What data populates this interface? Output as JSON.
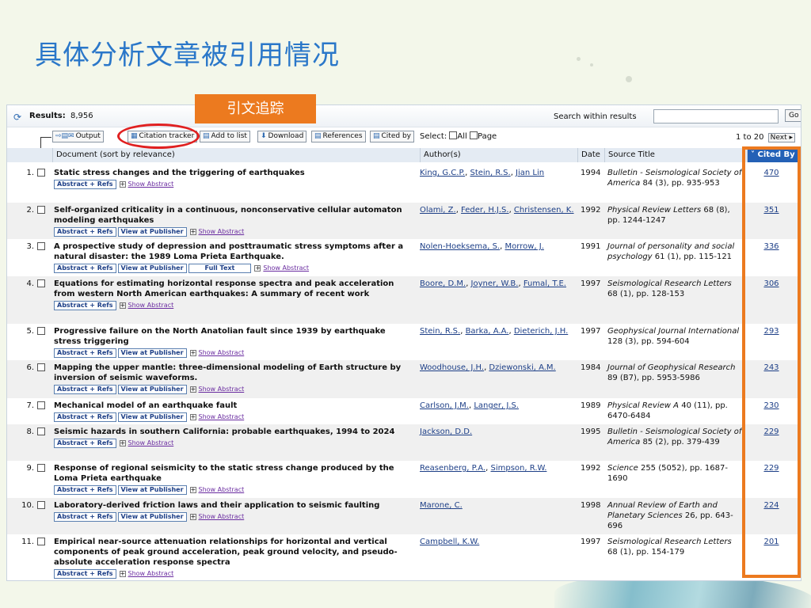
{
  "slide_title": "具体分析文章被引用情况",
  "callout_label": "引文追踪",
  "results": {
    "label": "Results:",
    "count": "8,956"
  },
  "search": {
    "label": "Search within results",
    "value": "",
    "go_label": "Go"
  },
  "toolbar": {
    "output": "Output",
    "citation_tracker": "Citation tracker",
    "add_to_list": "Add to list",
    "download": "Download",
    "references": "References",
    "cited_by": "Cited by"
  },
  "select": {
    "label": "Select:",
    "all": "All",
    "page": "Page"
  },
  "paging": {
    "range": "1 to 20",
    "next": "Next"
  },
  "columns": {
    "document": "Document (sort by relevance)",
    "authors": "Author(s)",
    "date": "Date",
    "source": "Source Title",
    "cited_by": "Cited By"
  },
  "link_labels": {
    "abstract_refs": "Abstract + Refs",
    "view_publisher": "View at Publisher",
    "full_text": "Full Text",
    "show_abstract": "Show Abstract"
  },
  "rows": [
    {
      "num": "1.",
      "title": "Static stress changes and the triggering of earthquakes",
      "authors": [
        "King, G.C.P.",
        "Stein, R.S.",
        "Jian Lin"
      ],
      "year": "1994",
      "source_title": "Bulletin - Seismological Society of America",
      "source_detail": "84 (3), pp. 935-953",
      "cited": "470",
      "publisher": false,
      "fulltext": false
    },
    {
      "num": "2.",
      "title": "Self-organized criticality in a continuous, nonconservative cellular automaton modeling earthquakes",
      "authors": [
        "Olami, Z.",
        "Feder, H.J.S.",
        "Christensen, K."
      ],
      "year": "1992",
      "source_title": "Physical Review Letters",
      "source_detail": "68 (8), pp. 1244-1247",
      "cited": "351",
      "publisher": true,
      "fulltext": false
    },
    {
      "num": "3.",
      "title": "A prospective study of depression and posttraumatic stress symptoms after a natural disaster: the 1989 Loma Prieta Earthquake.",
      "authors": [
        "Nolen-Hoeksema, S.",
        "Morrow, J."
      ],
      "year": "1991",
      "source_title": "Journal of personality and social psychology",
      "source_detail": "61 (1), pp. 115-121",
      "cited": "336",
      "publisher": true,
      "fulltext": true
    },
    {
      "num": "4.",
      "title": "Equations for estimating horizontal response spectra and peak acceleration from western North American earthquakes: A summary of recent work",
      "authors": [
        "Boore, D.M.",
        "Joyner, W.B.",
        "Fumal, T.E."
      ],
      "year": "1997",
      "source_title": "Seismological Research Letters",
      "source_detail": "68 (1), pp. 128-153",
      "cited": "306",
      "publisher": false,
      "fulltext": false
    },
    {
      "num": "5.",
      "title": "Progressive failure on the North Anatolian fault since 1939 by earthquake stress triggering",
      "authors": [
        "Stein, R.S.",
        "Barka, A.A.",
        "Dieterich, J.H."
      ],
      "year": "1997",
      "source_title": "Geophysical Journal International",
      "source_detail": "128 (3), pp. 594-604",
      "cited": "293",
      "publisher": true,
      "fulltext": false
    },
    {
      "num": "6.",
      "title": "Mapping the upper mantle: three-dimensional modeling of Earth structure by inversion of seismic waveforms.",
      "authors": [
        "Woodhouse, J.H.",
        "Dziewonski, A.M."
      ],
      "year": "1984",
      "source_title": "Journal of Geophysical Research",
      "source_detail": "89 (B7), pp. 5953-5986",
      "cited": "243",
      "publisher": true,
      "fulltext": false
    },
    {
      "num": "7.",
      "title": "Mechanical model of an earthquake fault",
      "authors": [
        "Carlson, J.M.",
        "Langer, J.S."
      ],
      "year": "1989",
      "source_title": "Physical Review A",
      "source_detail": "40 (11), pp. 6470-6484",
      "cited": "230",
      "publisher": true,
      "fulltext": false
    },
    {
      "num": "8.",
      "title": "Seismic hazards in southern California: probable earthquakes, 1994 to 2024",
      "authors": [
        "Jackson, D.D."
      ],
      "year": "1995",
      "source_title": "Bulletin - Seismological Society of America",
      "source_detail": "85 (2), pp. 379-439",
      "cited": "229",
      "publisher": false,
      "fulltext": false
    },
    {
      "num": "9.",
      "title": "Response of regional seismicity to the static stress change produced by the Loma Prieta earthquake",
      "authors": [
        "Reasenberg, P.A.",
        "Simpson, R.W."
      ],
      "year": "1992",
      "source_title": "Science",
      "source_detail": "255 (5052), pp. 1687-1690",
      "cited": "229",
      "publisher": true,
      "fulltext": false
    },
    {
      "num": "10.",
      "title": "Laboratory-derived friction laws and their application to seismic faulting",
      "authors": [
        "Marone, C."
      ],
      "year": "1998",
      "source_title": "Annual Review of Earth and Planetary Sciences",
      "source_detail": "26, pp. 643-696",
      "cited": "224",
      "publisher": true,
      "fulltext": false
    },
    {
      "num": "11.",
      "title": "Empirical near-source attenuation relationships for horizontal and vertical components of peak ground acceleration, peak ground velocity, and pseudo-absolute acceleration response spectra",
      "authors": [
        "Campbell, K.W."
      ],
      "year": "1997",
      "source_title": "Seismological Research Letters",
      "source_detail": "68 (1), pp. 154-179",
      "cited": "201",
      "publisher": false,
      "fulltext": false
    }
  ]
}
